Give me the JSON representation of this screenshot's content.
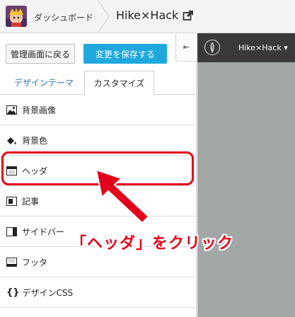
{
  "topbar": {
    "dashboard_label": "ダッシュボード",
    "blog_title": "Hike×Hack"
  },
  "panel": {
    "admin_button": "管理画面に戻る",
    "save_button": "変更を保存する",
    "collapse_glyph": "⇤",
    "tabs": {
      "design": "デザインテーマ",
      "customize": "カスタマイズ"
    },
    "items": [
      {
        "label": "背景画像",
        "icon": "image-icon"
      },
      {
        "label": "背景色",
        "icon": "paint-bucket-icon"
      },
      {
        "label": "ヘッダ",
        "icon": "header-layout-icon"
      },
      {
        "label": "記事",
        "icon": "article-layout-icon"
      },
      {
        "label": "サイドバー",
        "icon": "sidebar-layout-icon"
      },
      {
        "label": "フッタ",
        "icon": "footer-layout-icon"
      },
      {
        "label": "デザインCSS",
        "icon": "css-braces-icon",
        "glyph": "{}"
      }
    ]
  },
  "preview": {
    "title": "Hike×Hack ▾"
  },
  "annotation": {
    "text": "「ヘッダ」をクリック",
    "color": "#e3001b"
  },
  "colors": {
    "accent": "#1fa8dc",
    "highlight": "#e3001b",
    "preview_bg": "#a3a8a6",
    "preview_header": "#3a3a3a"
  }
}
